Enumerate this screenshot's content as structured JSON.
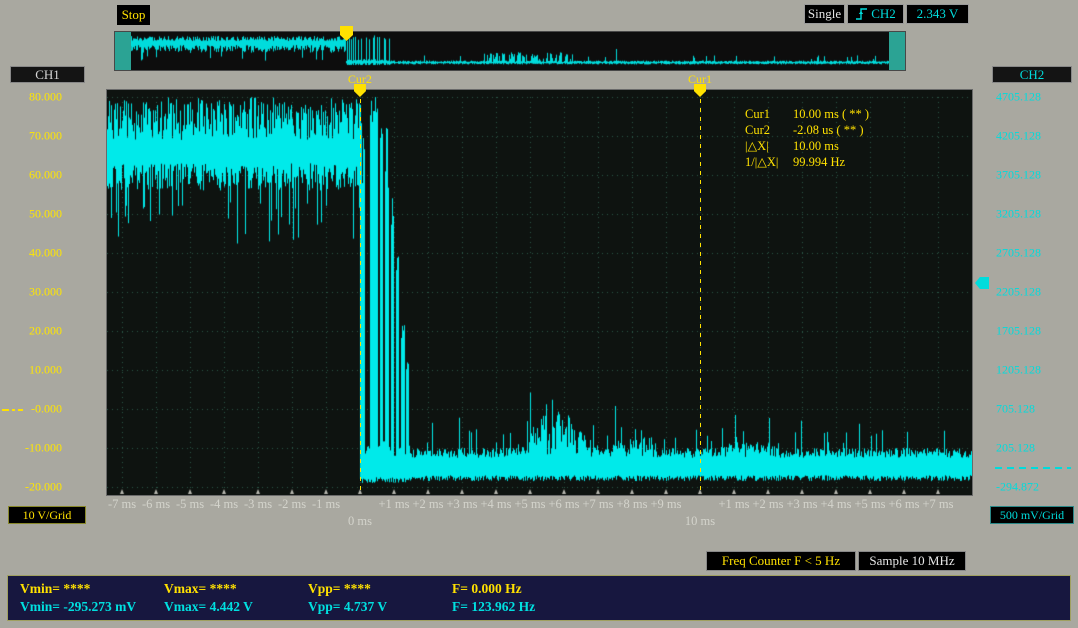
{
  "top_bar": {
    "stop_label": "Stop",
    "single_label": "Single",
    "trigger_channel": "CH2",
    "trigger_level": "2.343 V"
  },
  "left_axis": {
    "channel": "CH1",
    "labels": [
      "80.000",
      "70.000",
      "60.000",
      "50.000",
      "40.000",
      "30.000",
      "20.000",
      "10.000",
      "-0.000",
      "-10.000",
      "-20.000"
    ],
    "scale_label": "10 V/Grid"
  },
  "right_axis": {
    "channel": "CH2",
    "labels": [
      "4705.128",
      "4205.128",
      "3705.128",
      "3205.128",
      "2705.128",
      "2205.128",
      "1705.128",
      "1205.128",
      "705.128",
      "205.128",
      "-294.872"
    ],
    "scale_label": "500 mV/Grid"
  },
  "x_axis": {
    "minor_ticks": [
      {
        "t": -7,
        "label": "-7 ms"
      },
      {
        "t": -6,
        "label": "-6 ms"
      },
      {
        "t": -5,
        "label": "-5 ms"
      },
      {
        "t": -4,
        "label": "-4 ms"
      },
      {
        "t": -3,
        "label": "-3 ms"
      },
      {
        "t": -2,
        "label": "-2 ms"
      },
      {
        "t": -1,
        "label": "-1 ms"
      },
      {
        "t": 1,
        "label": "+1 ms"
      },
      {
        "t": 2,
        "label": "+2 ms"
      },
      {
        "t": 3,
        "label": "+3 ms"
      },
      {
        "t": 4,
        "label": "+4 ms"
      },
      {
        "t": 5,
        "label": "+5 ms"
      },
      {
        "t": 6,
        "label": "+6 ms"
      },
      {
        "t": 7,
        "label": "+7 ms"
      },
      {
        "t": 8,
        "label": "+8 ms"
      },
      {
        "t": 9,
        "label": "+9 ms"
      },
      {
        "t": 11,
        "label": "+1 ms"
      },
      {
        "t": 12,
        "label": "+2 ms"
      },
      {
        "t": 13,
        "label": "+3 ms"
      },
      {
        "t": 14,
        "label": "+4 ms"
      },
      {
        "t": 15,
        "label": "+5 ms"
      },
      {
        "t": 16,
        "label": "+6 ms"
      },
      {
        "t": 17,
        "label": "+7 ms"
      }
    ],
    "major_ticks": [
      {
        "t": 0,
        "label": "0 ms"
      },
      {
        "t": 10,
        "label": "10 ms"
      }
    ]
  },
  "cursors": {
    "cur1": {
      "name": "Cur1",
      "t_ms": 10.0
    },
    "cur2": {
      "name": "Cur2",
      "t_ms": -0.00208
    },
    "readout": [
      {
        "label": "Cur1",
        "value": "10.00 ms ( ** )"
      },
      {
        "label": "Cur2",
        "value": "-2.08 us ( ** )"
      },
      {
        "label": "|△X|",
        "value": "10.00 ms"
      },
      {
        "label": "1/|△X|",
        "value": "99.994 Hz"
      }
    ]
  },
  "status": {
    "freq_counter": "Freq Counter F < 5 Hz",
    "sample_rate": "Sample 10 MHz"
  },
  "measurements": {
    "row1": [
      "Vmin= ****",
      "Vmax= ****",
      "Vpp= ****",
      "F= 0.000 Hz"
    ],
    "row2": [
      "Vmin= -295.273 mV",
      "Vmax= 4.442 V",
      "Vpp= 4.737 V",
      "F= 123.962 Hz"
    ]
  },
  "colors": {
    "accent_yellow": "#ffe100",
    "accent_cyan": "#00dcdc",
    "waveform": "#00eaea",
    "grid_dots": "#2a5747",
    "plot_bg": "#0e1310",
    "strip_bg": "#0d0d0d",
    "teal_mask": "#2ba394",
    "panel_bg": "#17173f"
  },
  "chart_data": {
    "type": "line",
    "series_name": "CH2 waveform",
    "x_unit": "ms",
    "x_visible_range": [
      -7.44,
      18.0
    ],
    "y_unit": "V (CH1 grid scale, 10 V/div)",
    "y_visible_range": [
      -22,
      82
    ],
    "grid": "dotted, 1 ms per horizontal division, 10 V per vertical division",
    "pre_trigger": {
      "base": 68,
      "band": [
        53,
        80
      ],
      "rare_dip_to": 44
    },
    "transition_spikes": [
      {
        "t": 0.0,
        "peak": 78
      },
      {
        "t": 0.1,
        "peak": 70
      },
      {
        "t": 0.32,
        "peak": 80
      },
      {
        "t": 0.4,
        "peak": 80
      },
      {
        "t": 0.48,
        "peak": 78
      },
      {
        "t": 0.62,
        "peak": 72
      },
      {
        "t": 0.78,
        "peak": 76
      },
      {
        "t": 0.95,
        "peak": 55
      },
      {
        "t": 1.1,
        "peak": 40
      },
      {
        "t": 1.25,
        "peak": 22
      },
      {
        "t": 1.38,
        "peak": 12
      }
    ],
    "post_trigger": {
      "base": -14,
      "band": [
        -18,
        -11
      ],
      "occasional_spikes_to": -4,
      "noise_bump": {
        "t_start": 4.3,
        "t_end": 7.3,
        "peak_to": 0
      }
    },
    "cursor1_t_ms": 10.0,
    "cursor2_t_ms": -0.00208,
    "description": "Noisy high level near 68 (CH1 scale) before t=0; abrupt fall at trigger with a burst of narrow full-height spikes until +1.4 ms; then noisy low level near -14 with small spikes and a broader noise bump between +4.3 and +7.3 ms."
  }
}
